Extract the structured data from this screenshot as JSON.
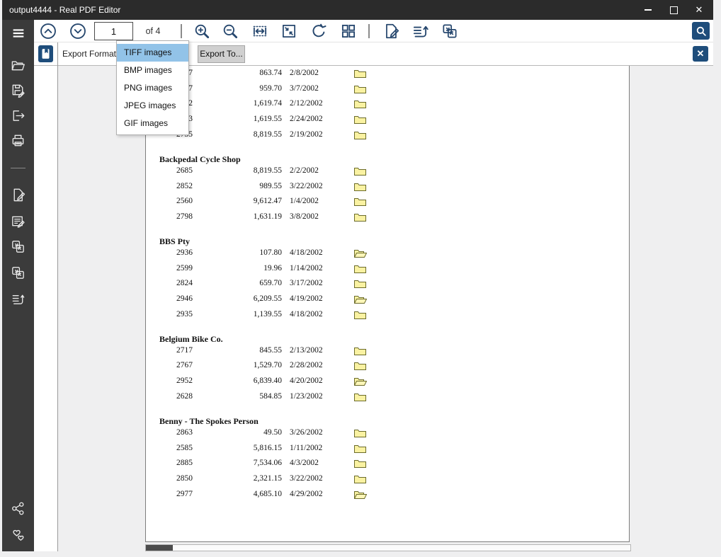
{
  "window": {
    "title": "output4444 - Real PDF Editor",
    "controls": {
      "minimize": "minimize",
      "maximize": "maximize",
      "close_glyph": "✕"
    }
  },
  "sidebar": {
    "icons": [
      "menu",
      "open-file",
      "save-as",
      "export-file",
      "print",
      "edit-page",
      "edit-content",
      "convert-pages-a",
      "convert-pages-b",
      "extract-pages",
      "share",
      "donate"
    ]
  },
  "toolbar": {
    "page_number": "1",
    "page_count_label": "of 4",
    "icons": [
      "previous-page",
      "next-page",
      "zoom-in",
      "zoom-out",
      "fit-width",
      "fit-page",
      "rotate",
      "page-thumbnails",
      "edit-document",
      "export-list",
      "convert-document",
      "search"
    ]
  },
  "export_bar": {
    "bookmark_icon": "bookmarks",
    "label": "Export Formats:",
    "export_button_label": "Export To...",
    "close_glyph": "✕"
  },
  "format_dropdown": {
    "items": [
      "TIFF images",
      "BMP images",
      "PNG images",
      "JPEG images",
      "GIF images"
    ],
    "selected": "TIFF images"
  },
  "document": {
    "groups": [
      {
        "customer": "",
        "rows": [
          {
            "id": "2697",
            "amount": "863.74",
            "date": "2/8/2002",
            "folder": "closed"
          },
          {
            "id": "2797",
            "amount": "959.70",
            "date": "3/7/2002",
            "folder": "closed"
          },
          {
            "id": "2712",
            "amount": "1,619.74",
            "date": "2/12/2002",
            "folder": "closed"
          },
          {
            "id": "2753",
            "amount": "1,619.55",
            "date": "2/24/2002",
            "folder": "closed"
          },
          {
            "id": "2735",
            "amount": "8,819.55",
            "date": "2/19/2002",
            "folder": "closed"
          }
        ]
      },
      {
        "customer": "Backpedal Cycle Shop",
        "rows": [
          {
            "id": "2685",
            "amount": "8,819.55",
            "date": "2/2/2002",
            "folder": "closed"
          },
          {
            "id": "2852",
            "amount": "989.55",
            "date": "3/22/2002",
            "folder": "closed"
          },
          {
            "id": "2560",
            "amount": "9,612.47",
            "date": "1/4/2002",
            "folder": "closed"
          },
          {
            "id": "2798",
            "amount": "1,631.19",
            "date": "3/8/2002",
            "folder": "closed"
          }
        ]
      },
      {
        "customer": "BBS Pty",
        "rows": [
          {
            "id": "2936",
            "amount": "107.80",
            "date": "4/18/2002",
            "folder": "open"
          },
          {
            "id": "2599",
            "amount": "19.96",
            "date": "1/14/2002",
            "folder": "closed"
          },
          {
            "id": "2824",
            "amount": "659.70",
            "date": "3/17/2002",
            "folder": "closed"
          },
          {
            "id": "2946",
            "amount": "6,209.55",
            "date": "4/19/2002",
            "folder": "open"
          },
          {
            "id": "2935",
            "amount": "1,139.55",
            "date": "4/18/2002",
            "folder": "closed"
          }
        ]
      },
      {
        "customer": "Belgium Bike Co.",
        "rows": [
          {
            "id": "2717",
            "amount": "845.55",
            "date": "2/13/2002",
            "folder": "closed"
          },
          {
            "id": "2767",
            "amount": "1,529.70",
            "date": "2/28/2002",
            "folder": "closed"
          },
          {
            "id": "2952",
            "amount": "6,839.40",
            "date": "4/20/2002",
            "folder": "open"
          },
          {
            "id": "2628",
            "amount": "584.85",
            "date": "1/23/2002",
            "folder": "closed"
          }
        ]
      },
      {
        "customer": "Benny - The Spokes Person",
        "rows": [
          {
            "id": "2863",
            "amount": "49.50",
            "date": "3/26/2002",
            "folder": "closed"
          },
          {
            "id": "2585",
            "amount": "5,816.15",
            "date": "1/11/2002",
            "folder": "closed"
          },
          {
            "id": "2885",
            "amount": "7,534.06",
            "date": "4/3/2002",
            "folder": "closed"
          },
          {
            "id": "2850",
            "amount": "2,321.15",
            "date": "3/22/2002",
            "folder": "closed"
          },
          {
            "id": "2977",
            "amount": "4,685.10",
            "date": "4/29/2002",
            "folder": "open"
          }
        ]
      }
    ]
  },
  "colors": {
    "accent_navy": "#1e4d7b",
    "icon_navy": "#26476e",
    "titlebar": "#2b2b2b",
    "sidebar": "#3b3b3b",
    "dropdown_highlight": "#92c3e8",
    "folder_yellow": "#faf2a2",
    "viewer_bg": "#efeff0"
  }
}
